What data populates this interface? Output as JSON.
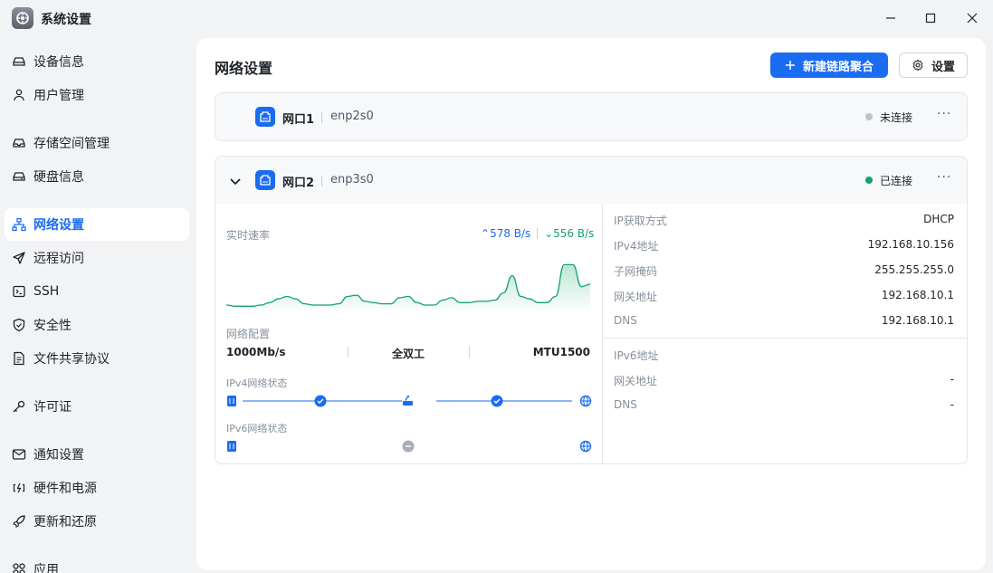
{
  "window": {
    "title": "系统设置"
  },
  "sidebar": {
    "items": [
      {
        "label": "设备信息",
        "icon": "drive-icon"
      },
      {
        "label": "用户管理",
        "icon": "user-icon"
      },
      {
        "label": "存储空间管理",
        "icon": "storage-icon"
      },
      {
        "label": "硬盘信息",
        "icon": "disk-icon"
      },
      {
        "label": "网络设置",
        "icon": "network-icon",
        "active": true
      },
      {
        "label": "远程访问",
        "icon": "send-icon"
      },
      {
        "label": "SSH",
        "icon": "terminal-icon"
      },
      {
        "label": "安全性",
        "icon": "shield-icon"
      },
      {
        "label": "文件共享协议",
        "icon": "file-icon"
      },
      {
        "label": "许可证",
        "icon": "key-icon"
      },
      {
        "label": "通知设置",
        "icon": "mail-icon"
      },
      {
        "label": "硬件和电源",
        "icon": "power-icon"
      },
      {
        "label": "更新和还原",
        "icon": "rocket-icon"
      },
      {
        "label": "应用",
        "icon": "apps-icon"
      }
    ]
  },
  "main": {
    "title": "网络设置",
    "new_bond_label": "新建链路聚合",
    "settings_label": "设置",
    "ports": [
      {
        "name": "网口1",
        "device": "enp2s0",
        "status": "未连接"
      },
      {
        "name": "网口2",
        "device": "enp3s0",
        "status": "已连接"
      }
    ],
    "speed": {
      "label": "实时速率",
      "upload": "578 B/s",
      "download": "556 B/s",
      "samples": [
        3,
        2,
        2,
        2,
        3,
        5,
        8,
        10,
        8,
        4,
        3,
        3,
        3,
        4,
        10,
        11,
        6,
        5,
        4,
        4,
        9,
        10,
        5,
        3,
        3,
        7,
        9,
        5,
        5,
        6,
        6,
        7,
        13,
        27,
        10,
        8,
        5,
        5,
        10,
        36,
        36,
        18,
        20
      ]
    },
    "net_config": {
      "label": "网络配置",
      "speed": "1000Mb/s",
      "duplex": "全双工",
      "mtu": "MTU1500"
    },
    "ipv4_status_label": "IPv4网络状态",
    "ipv6_status_label": "IPv6网络状态",
    "ipv4_info": [
      {
        "k": "IP获取方式",
        "v": "DHCP"
      },
      {
        "k": "IPv4地址",
        "v": "192.168.10.156"
      },
      {
        "k": "子网掩码",
        "v": "255.255.255.0"
      },
      {
        "k": "网关地址",
        "v": "192.168.10.1"
      },
      {
        "k": "DNS",
        "v": "192.168.10.1"
      }
    ],
    "ipv6_info": [
      {
        "k": "IPv6地址",
        "v": ""
      },
      {
        "k": "网关地址",
        "v": "-"
      },
      {
        "k": "DNS",
        "v": "-"
      }
    ]
  },
  "colors": {
    "accent": "#1a6cf2",
    "connected": "#12a26a",
    "disconnected": "#bfc3c9"
  }
}
